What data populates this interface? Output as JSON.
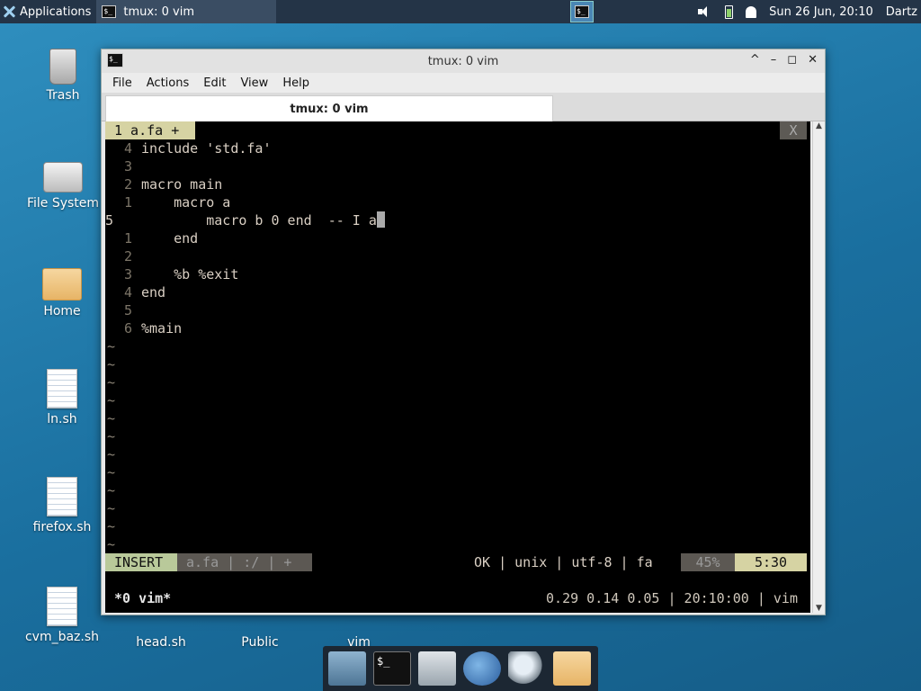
{
  "top_panel": {
    "applications_label": "Applications",
    "task_title": "tmux: 0 vim",
    "clock": "Sun 26 Jun, 20:10",
    "user": "Dartz"
  },
  "desktop_icons": [
    {
      "label": "Trash",
      "icon": "trash-icon"
    },
    {
      "label": "File System",
      "icon": "drive-icon"
    },
    {
      "label": "Home",
      "icon": "home-folder-icon"
    },
    {
      "label": "ln.sh",
      "icon": "script-icon"
    },
    {
      "label": "firefox.sh",
      "icon": "script-icon"
    },
    {
      "label": "cvm_baz.sh",
      "icon": "script-icon"
    },
    {
      "label": "head.sh",
      "icon": "script-icon"
    },
    {
      "label": "Public",
      "icon": "folder-icon"
    },
    {
      "label": "vim",
      "icon": "file-icon"
    }
  ],
  "window": {
    "title": "tmux: 0 vim",
    "menu": [
      "File",
      "Actions",
      "Edit",
      "View",
      "Help"
    ],
    "tab_title": "tmux: 0 vim"
  },
  "vim": {
    "tab_label": "1 a.fa +",
    "close_label": "X",
    "lines": [
      {
        "num": "4",
        "text": "include 'std.fa'"
      },
      {
        "num": "3",
        "text": ""
      },
      {
        "num": "2",
        "text": "macro main"
      },
      {
        "num": "1",
        "text": "    macro a"
      },
      {
        "num": "5",
        "text": "        macro b 0 end  -- I a",
        "current": true
      },
      {
        "num": "1",
        "text": "    end"
      },
      {
        "num": "2",
        "text": ""
      },
      {
        "num": "3",
        "text": "    %b %exit"
      },
      {
        "num": "4",
        "text": "end"
      },
      {
        "num": "5",
        "text": ""
      },
      {
        "num": "6",
        "text": "%main"
      }
    ],
    "tildes": 12,
    "status": {
      "mode": "INSERT",
      "file": "a.fa | :/ | +",
      "info": "OK | unix | utf-8 | fa",
      "percent": "45%",
      "position": "5:30"
    }
  },
  "tmux": {
    "window": "*0 vim*",
    "right": "0.29 0.14 0.05 | 20:10:00 | vim"
  }
}
